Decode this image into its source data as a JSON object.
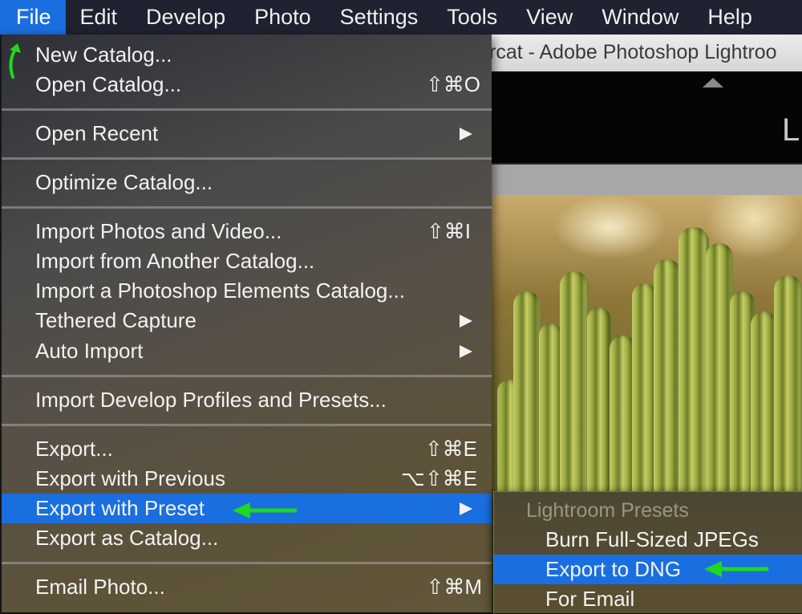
{
  "menubar": {
    "items": [
      "File",
      "Edit",
      "Develop",
      "Photo",
      "Settings",
      "Tools",
      "View",
      "Window",
      "Help"
    ],
    "active": "File"
  },
  "background_app": {
    "window_title": "rcat - Adobe Photoshop Lightroo",
    "module_letter": "L"
  },
  "file_menu": {
    "new_catalog": "New Catalog...",
    "open_catalog": "Open Catalog...",
    "open_catalog_shortcut": "⇧⌘O",
    "open_recent": "Open Recent",
    "optimize_catalog": "Optimize Catalog...",
    "import_photos": "Import Photos and Video...",
    "import_photos_shortcut": "⇧⌘I",
    "import_another": "Import from Another Catalog...",
    "import_elements": "Import a Photoshop Elements Catalog...",
    "tethered_capture": "Tethered Capture",
    "auto_import": "Auto Import",
    "import_profiles": "Import Develop Profiles and Presets...",
    "export": "Export...",
    "export_shortcut": "⇧⌘E",
    "export_previous": "Export with Previous",
    "export_previous_shortcut": "⌥⇧⌘E",
    "export_preset": "Export with Preset",
    "export_catalog": "Export as Catalog...",
    "email_photo": "Email Photo...",
    "email_photo_shortcut": "⇧⌘M"
  },
  "submenu": {
    "header": "Lightroom Presets",
    "burn_jpegs": "Burn Full-Sized JPEGs",
    "export_dng": "Export to DNG",
    "for_email": "For Email"
  },
  "colors": {
    "highlight": "#1a6fe0",
    "annotation": "#1fd81f"
  }
}
